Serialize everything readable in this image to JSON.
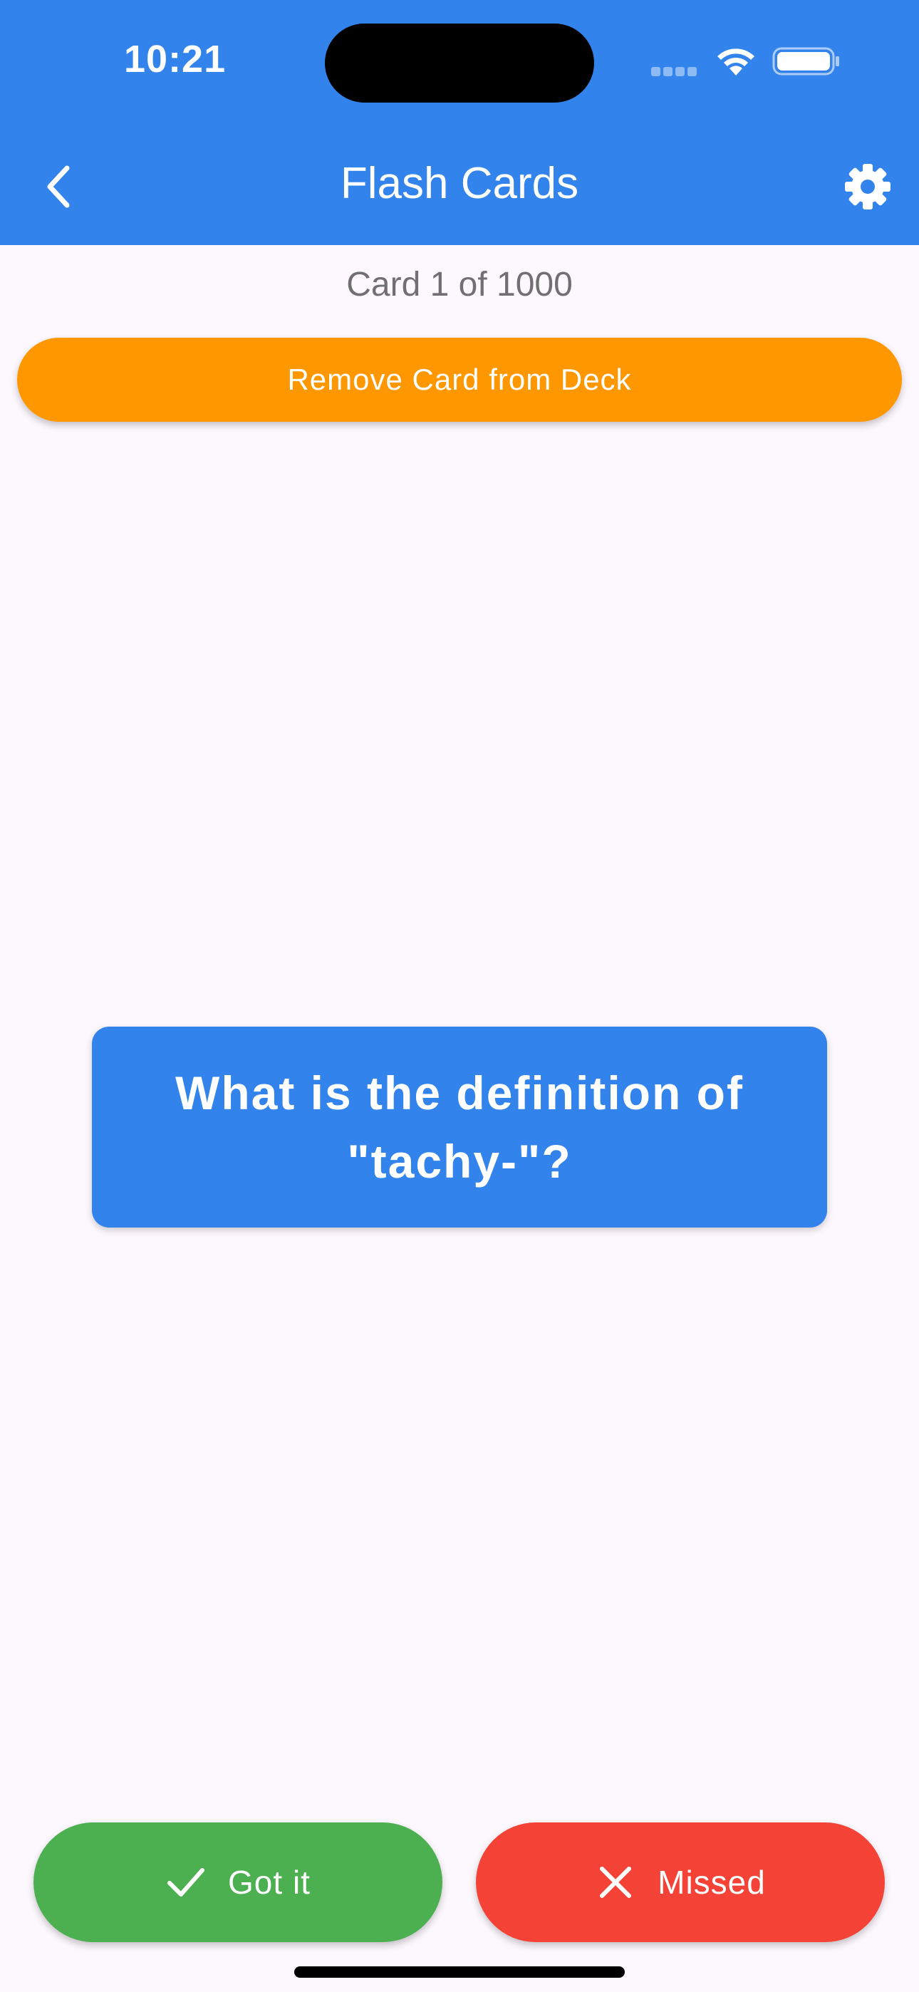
{
  "status_bar": {
    "time": "10:21"
  },
  "header": {
    "title": "Flash Cards",
    "back_icon": "chevron-left-icon",
    "settings_icon": "gear-icon",
    "background_color": "#3283EC"
  },
  "progress": {
    "counter_text": "Card 1 of 1000",
    "current_card": 1,
    "total_cards": 1000
  },
  "actions": {
    "remove_label": "Remove Card from Deck",
    "remove_color": "#FF9800"
  },
  "card": {
    "question": "What is the definition of \"tachy-\"?",
    "color": "#3283EC"
  },
  "answer_buttons": {
    "got_it_label": "Got it",
    "got_it_icon": "checkmark-icon",
    "got_it_color": "#4CAF50",
    "missed_label": "Missed",
    "missed_icon": "close-icon",
    "missed_color": "#F44336"
  }
}
